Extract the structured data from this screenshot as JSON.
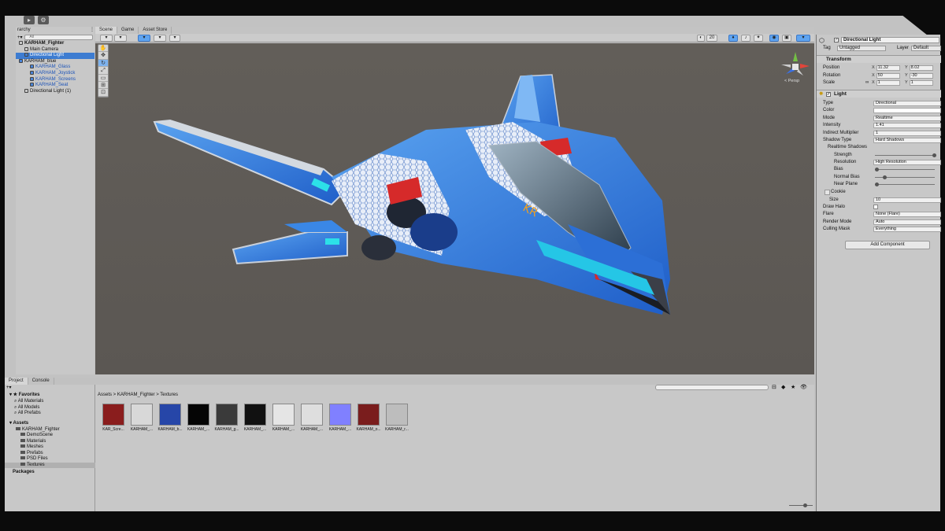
{
  "hierarchy": {
    "tab_label": "rarchy",
    "search_placeholder": "All",
    "items": [
      {
        "label": "KARHAM_Fighter",
        "kind": "root",
        "indent": 0
      },
      {
        "label": "Main Camera",
        "kind": "normal",
        "indent": 1
      },
      {
        "label": "Directional Light",
        "kind": "selected",
        "indent": 1
      },
      {
        "label": "KARHAM_blue",
        "kind": "prefab",
        "indent": 0
      },
      {
        "label": "KARHAM_Glass",
        "kind": "prefab",
        "indent": 2
      },
      {
        "label": "KARHAM_Joystick",
        "kind": "prefab",
        "indent": 2
      },
      {
        "label": "KARHAM_Screens",
        "kind": "prefab",
        "indent": 2
      },
      {
        "label": "KARHAM_Seat",
        "kind": "prefab",
        "indent": 2
      },
      {
        "label": "Directional Light (1)",
        "kind": "normal",
        "indent": 1
      }
    ]
  },
  "scene": {
    "tabs": [
      "Scene",
      "Game",
      "Asset Store"
    ],
    "toolbar_count": "20",
    "persp_label": "< Persp"
  },
  "inspector": {
    "object_name": "Directional Light",
    "tag_label": "Tag",
    "tag_value": "Untagged",
    "layer_label": "Layer",
    "layer_value": "Default",
    "transform": {
      "header": "Transform",
      "position_label": "Position",
      "position": {
        "x": "11.32",
        "y": "8.02"
      },
      "rotation_label": "Rotation",
      "rotation": {
        "x": "50",
        "y": "-30"
      },
      "scale_label": "Scale",
      "scale": {
        "x": "1",
        "y": "1"
      }
    },
    "light": {
      "header": "Light",
      "rows": [
        {
          "label": "Type",
          "value": "Directional"
        },
        {
          "label": "Color",
          "value": ""
        },
        {
          "label": "Mode",
          "value": "Realtime"
        },
        {
          "label": "Intensity",
          "value": "1.41"
        },
        {
          "label": "Indirect Multiplier",
          "value": "1"
        },
        {
          "label": "Shadow Type",
          "value": "Hard Shadows"
        }
      ],
      "realtime_shadows_label": "Realtime Shadows",
      "strength_label": "Strength",
      "strength_value": 1,
      "resolution_label": "Resolution",
      "resolution_value": "High Resolution",
      "bias_label": "Bias",
      "normal_bias_label": "Normal Bias",
      "near_plane_label": "Near Plane",
      "cookie_label": "Cookie",
      "size_label": "Size",
      "size_value": "10",
      "draw_halo_label": "Draw Halo",
      "flare_label": "Flare",
      "flare_value": "None (Flare)",
      "render_mode_label": "Render Mode",
      "render_mode_value": "Auto",
      "culling_mask_label": "Culling Mask",
      "culling_mask_value": "Everything"
    },
    "add_component_label": "Add Component"
  },
  "project": {
    "tabs": [
      "Project",
      "Console"
    ],
    "favorites_label": "Favorites",
    "favorites": [
      "All Materials",
      "All Models",
      "All Prefabs"
    ],
    "assets_label": "Assets",
    "assets_root": "KARHAM_Fighter",
    "folders": [
      "DemoScene",
      "Materials",
      "Meshes",
      "Prefabs",
      "PSD Files",
      "Textures"
    ],
    "packages_label": "Packages",
    "breadcrumb": [
      "Assets",
      "KARHAM_Fighter",
      "Textures"
    ],
    "thumbnails": [
      {
        "label": "KAR_Scre...",
        "color": "#8a1d1d"
      },
      {
        "label": "KARHAM_...",
        "color": "#d8d8d8"
      },
      {
        "label": "KARHAM_b...",
        "color": "#2646a8"
      },
      {
        "label": "KARHAM_...",
        "color": "#050505"
      },
      {
        "label": "KARHAM_g...",
        "color": "#3a3a3a"
      },
      {
        "label": "KARHAM_...",
        "color": "#111111"
      },
      {
        "label": "KARHAM_...",
        "color": "#e5e5e5"
      },
      {
        "label": "KARHAM_...",
        "color": "#dedede"
      },
      {
        "label": "KARHAM_...",
        "color": "#8080ff"
      },
      {
        "label": "KARHAM_o...",
        "color": "#7a1d1d"
      },
      {
        "label": "KARHAM_r...",
        "color": "#bdbdbd"
      }
    ]
  }
}
